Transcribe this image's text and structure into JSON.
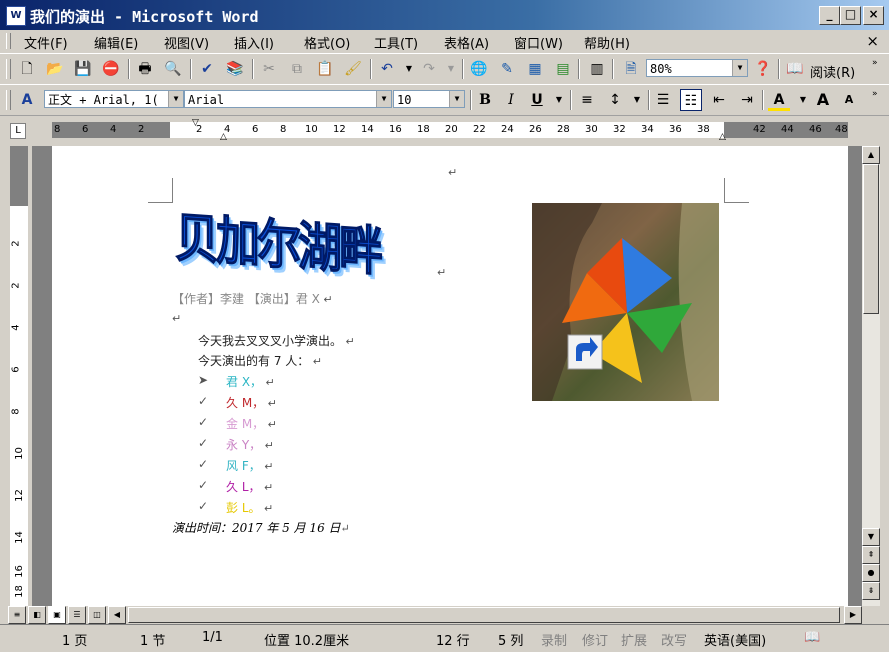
{
  "window": {
    "title": "我们的演出 - Microsoft Word",
    "app_icon": "W"
  },
  "menu": [
    "文件(F)",
    "编辑(E)",
    "视图(V)",
    "插入(I)",
    "格式(O)",
    "工具(T)",
    "表格(A)",
    "窗口(W)",
    "帮助(H)"
  ],
  "toolbar": {
    "zoom": "80%",
    "read_label": "阅读(R)"
  },
  "format": {
    "style": "正文 + Arial, 1(",
    "font": "Arial",
    "size": "10"
  },
  "ruler": {
    "h_ticks": [
      "8",
      "6",
      "4",
      "2",
      "2",
      "4",
      "6",
      "8",
      "10",
      "12",
      "14",
      "16",
      "18",
      "20",
      "22",
      "24",
      "26",
      "28",
      "30",
      "32",
      "34",
      "36",
      "38",
      "42",
      "44",
      "46",
      "48"
    ],
    "v_ticks": [
      "2",
      "2",
      "4",
      "6",
      "8",
      "10",
      "12",
      "14",
      "16",
      "18"
    ]
  },
  "document": {
    "wordart": "贝加尔湖畔",
    "byline": "【作者】李建 【演出】君 X",
    "line1": "今天我去叉叉叉小学演出。",
    "line2": "今天演出的有 7 人：",
    "performers": [
      {
        "bullet": "➤",
        "name": "君 X，",
        "color": "#2bb6c4"
      },
      {
        "bullet": "✓",
        "name": "久 M，",
        "color": "#c0282d"
      },
      {
        "bullet": "✓",
        "name": "金 M，",
        "color": "#d79bd2"
      },
      {
        "bullet": "✓",
        "name": "永 Y，",
        "color": "#c982c4"
      },
      {
        "bullet": "✓",
        "name": "风 F，",
        "color": "#33b4c4"
      },
      {
        "bullet": "✓",
        "name": "久 L，",
        "color": "#b01fa6"
      },
      {
        "bullet": "✓",
        "name": "彭 L。",
        "color": "#e6c800"
      }
    ],
    "date": "演出时间：2017 年 5 月 16 日"
  },
  "status": {
    "page": "1 页",
    "section": "1 节",
    "pages": "1/1",
    "position": "位置 10.2厘米",
    "line": "12 行",
    "col": "5 列",
    "rec": "录制",
    "trk": "修订",
    "ext": "扩展",
    "ovr": "改写",
    "lang": "英语(美国)"
  }
}
